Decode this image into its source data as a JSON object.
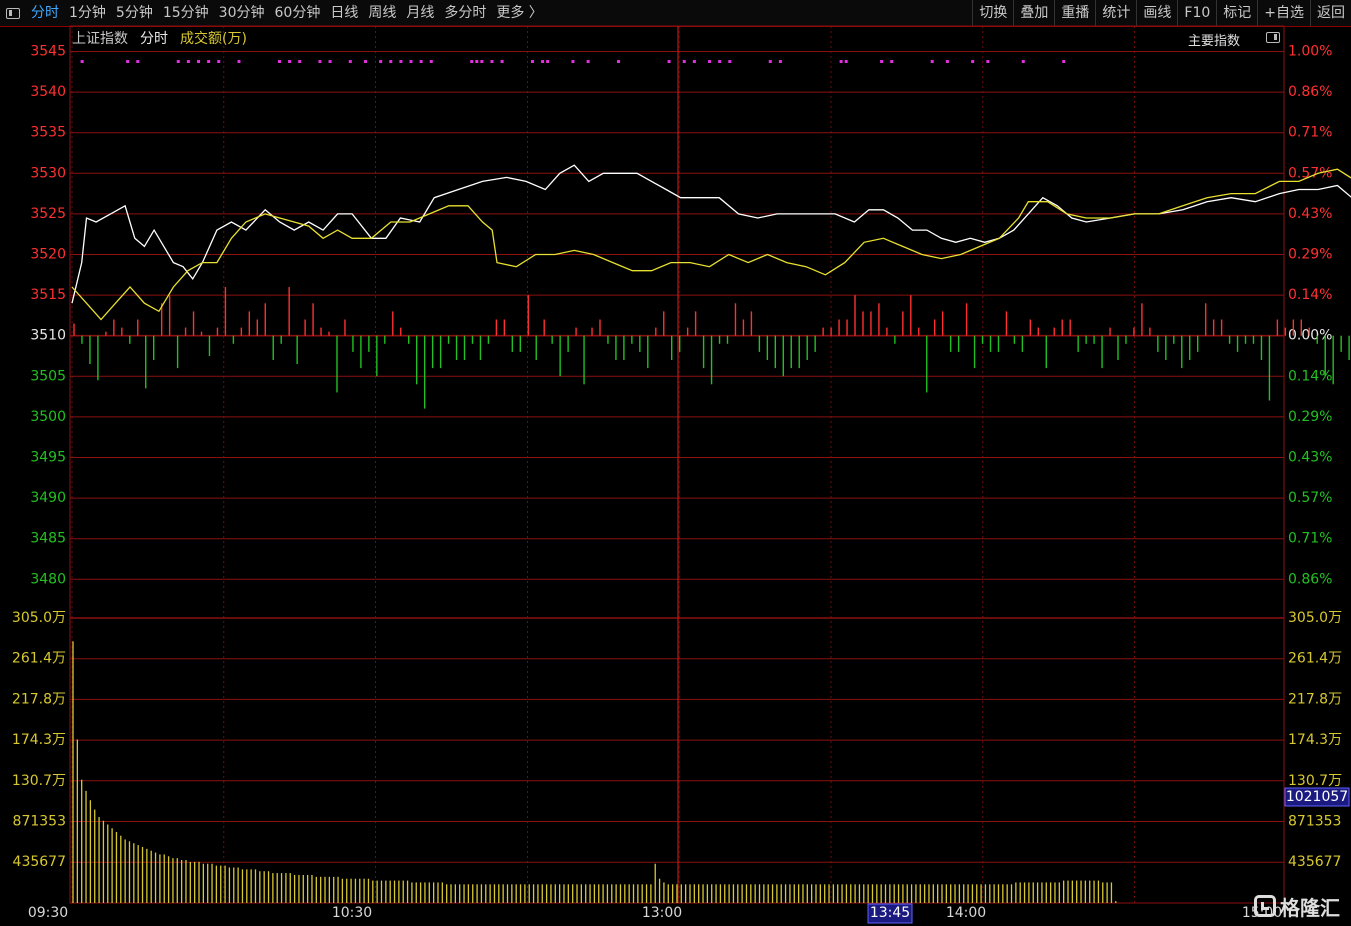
{
  "toolbar": {
    "left_items": [
      "分时",
      "1分钟",
      "5分钟",
      "15分钟",
      "30分钟",
      "60分钟",
      "日线",
      "周线",
      "月线",
      "多分时",
      "更多 〉"
    ],
    "right_items": [
      "切换",
      "叠加",
      "重播",
      "统计",
      "画线",
      "F10",
      "标记",
      "+自选",
      "返回"
    ],
    "active": "分时"
  },
  "header": {
    "index_name": "上证指数",
    "mode": "分时",
    "volume_label": "成交额(万)",
    "main_index_label": "主要指数"
  },
  "logo": {
    "text": "格隆汇"
  },
  "colors": {
    "up": "#ff3030",
    "down": "#22c022",
    "price_line": "#ffffff",
    "avg_line": "#e8e030",
    "grid": "#8b1010",
    "volume_bar": "#d8c830",
    "signal_marker": "#e030e0"
  },
  "chart_data": {
    "type": "line",
    "price_axis": {
      "ticks": [
        "3545",
        "3540",
        "3535",
        "3530",
        "3525",
        "3520",
        "3515",
        "3510",
        "3505",
        "3500",
        "3495",
        "3490",
        "3485",
        "3480"
      ],
      "ylim": [
        3478,
        3545
      ],
      "base": 3510
    },
    "pct_axis": {
      "ticks": [
        "1.00%",
        "0.86%",
        "0.71%",
        "0.57%",
        "0.43%",
        "0.29%",
        "0.14%",
        "0.00%",
        "0.14%",
        "0.29%",
        "0.43%",
        "0.57%",
        "0.71%",
        "0.86%"
      ]
    },
    "volume_axis": {
      "ticks": [
        "305.0万",
        "261.4万",
        "217.8万",
        "174.3万",
        "130.7万",
        "871353",
        "435677"
      ],
      "ylim": [
        0,
        3050000
      ]
    },
    "volume_cursor_label": "1021057",
    "time_axis": {
      "labels": [
        "09:30",
        "10:30",
        "13:00",
        "13:45",
        "14:00",
        "15:00"
      ],
      "highlight": "13:45"
    },
    "x_range": [
      0,
      240
    ],
    "cursor_minute": 150,
    "series": [
      {
        "name": "",
        "points": [
          [
            0,
            3514
          ],
          [
            2,
            3519
          ],
          [
            3,
            3524.5
          ],
          [
            5,
            3524
          ],
          [
            8,
            3525
          ],
          [
            11,
            3526
          ],
          [
            13,
            3522
          ],
          [
            15,
            3521
          ],
          [
            17,
            3523
          ],
          [
            19,
            3521
          ],
          [
            21,
            3519
          ],
          [
            23,
            3518.5
          ],
          [
            25,
            3517
          ],
          [
            27,
            3519
          ],
          [
            30,
            3523
          ],
          [
            33,
            3524
          ],
          [
            36,
            3523
          ],
          [
            40,
            3525.5
          ],
          [
            43,
            3524
          ],
          [
            46,
            3523
          ],
          [
            49,
            3524
          ],
          [
            52,
            3523
          ],
          [
            55,
            3525
          ],
          [
            58,
            3525
          ],
          [
            62,
            3522
          ],
          [
            65,
            3522
          ],
          [
            68,
            3524.5
          ],
          [
            72,
            3524
          ],
          [
            75,
            3527
          ],
          [
            80,
            3528
          ],
          [
            85,
            3529
          ],
          [
            90,
            3529.5
          ],
          [
            94,
            3529
          ],
          [
            98,
            3528
          ],
          [
            101,
            3530
          ],
          [
            104,
            3531
          ],
          [
            107,
            3529
          ],
          [
            110,
            3530
          ],
          [
            113,
            3530
          ],
          [
            117,
            3530
          ],
          [
            120,
            3529
          ],
          [
            123,
            3528
          ],
          [
            126,
            3527
          ],
          [
            130,
            3527
          ],
          [
            134,
            3527
          ],
          [
            138,
            3525
          ],
          [
            142,
            3524.5
          ],
          [
            146,
            3525
          ],
          [
            150,
            3525
          ],
          [
            154,
            3525
          ],
          [
            158,
            3525
          ],
          [
            162,
            3524
          ],
          [
            165,
            3525.5
          ],
          [
            168,
            3525.5
          ],
          [
            171,
            3524.5
          ],
          [
            174,
            3523
          ],
          [
            177,
            3523
          ],
          [
            180,
            3522
          ],
          [
            183,
            3521.5
          ],
          [
            186,
            3522
          ],
          [
            189,
            3521.5
          ],
          [
            192,
            3522
          ],
          [
            195,
            3523
          ],
          [
            198,
            3525
          ],
          [
            201,
            3527
          ],
          [
            204,
            3526
          ],
          [
            207,
            3524.5
          ],
          [
            210,
            3524
          ],
          [
            215,
            3524.5
          ],
          [
            220,
            3525
          ],
          [
            225,
            3525
          ],
          [
            230,
            3525.5
          ],
          [
            235,
            3526.5
          ],
          [
            240,
            3527
          ],
          [
            245,
            3526.5
          ],
          [
            250,
            3527.5
          ],
          [
            254,
            3528
          ],
          [
            258,
            3528
          ],
          [
            262,
            3528.5
          ],
          [
            266,
            3526.5
          ],
          [
            270,
            3524
          ],
          [
            274,
            3523
          ],
          [
            277,
            3523
          ]
        ],
        "color_key": "price_line"
      },
      {
        "name": "",
        "points": [
          [
            0,
            3516
          ],
          [
            3,
            3514
          ],
          [
            6,
            3512
          ],
          [
            9,
            3514
          ],
          [
            12,
            3516
          ],
          [
            15,
            3514
          ],
          [
            18,
            3513
          ],
          [
            21,
            3516
          ],
          [
            24,
            3518
          ],
          [
            27,
            3519
          ],
          [
            30,
            3519
          ],
          [
            33,
            3522
          ],
          [
            36,
            3524
          ],
          [
            40,
            3525
          ],
          [
            43,
            3524.5
          ],
          [
            46,
            3524
          ],
          [
            49,
            3523.5
          ],
          [
            52,
            3522
          ],
          [
            55,
            3523
          ],
          [
            58,
            3522
          ],
          [
            62,
            3522
          ],
          [
            66,
            3524
          ],
          [
            70,
            3524
          ],
          [
            74,
            3525
          ],
          [
            78,
            3526
          ],
          [
            82,
            3526
          ],
          [
            85,
            3524
          ],
          [
            87,
            3523
          ],
          [
            88,
            3519
          ],
          [
            92,
            3518.5
          ],
          [
            96,
            3520
          ],
          [
            100,
            3520
          ],
          [
            104,
            3520.5
          ],
          [
            108,
            3520
          ],
          [
            112,
            3519
          ],
          [
            116,
            3518
          ],
          [
            120,
            3518
          ],
          [
            124,
            3519
          ],
          [
            128,
            3519
          ],
          [
            132,
            3518.5
          ],
          [
            136,
            3520
          ],
          [
            140,
            3519
          ],
          [
            144,
            3520
          ],
          [
            148,
            3519
          ],
          [
            152,
            3518.5
          ],
          [
            156,
            3517.5
          ],
          [
            160,
            3519
          ],
          [
            164,
            3521.5
          ],
          [
            168,
            3522
          ],
          [
            172,
            3521
          ],
          [
            176,
            3520
          ],
          [
            180,
            3519.5
          ],
          [
            184,
            3520
          ],
          [
            188,
            3521
          ],
          [
            192,
            3522
          ],
          [
            196,
            3524.5
          ],
          [
            198,
            3526.5
          ],
          [
            202,
            3526.5
          ],
          [
            206,
            3525
          ],
          [
            210,
            3524.5
          ],
          [
            215,
            3524.5
          ],
          [
            220,
            3525
          ],
          [
            225,
            3525
          ],
          [
            230,
            3526
          ],
          [
            235,
            3527
          ],
          [
            240,
            3527.5
          ],
          [
            245,
            3527.5
          ],
          [
            250,
            3529
          ],
          [
            254,
            3529
          ],
          [
            258,
            3530
          ],
          [
            262,
            3530.5
          ],
          [
            266,
            3529
          ],
          [
            270,
            3528
          ],
          [
            274,
            3528.5
          ],
          [
            277,
            3528
          ]
        ],
        "color_key": "avg_line"
      }
    ],
    "diff_bars": [
      1.5,
      -1,
      -3.5,
      -5.5,
      0.5,
      2,
      1,
      -1,
      2,
      -6.5,
      -3,
      4,
      5,
      -4,
      1,
      3,
      0.5,
      -2.5,
      1,
      6,
      -1,
      1,
      3,
      2,
      4,
      -3,
      -1,
      6,
      -3.5,
      2,
      4,
      1,
      0.5,
      -7,
      2,
      -2,
      -4,
      -2,
      -5,
      -1,
      3,
      1,
      -1,
      -6,
      -9,
      -4,
      -4,
      -1,
      -3,
      -3,
      -1,
      -3,
      -1,
      2,
      2,
      -2,
      -2,
      5,
      -3,
      2,
      -1,
      -5,
      -2,
      1,
      -6,
      1,
      2,
      -1,
      -3,
      -3,
      -1,
      -2,
      -4,
      1,
      3,
      -3,
      -2,
      1,
      3,
      -4,
      -6,
      -1,
      -1,
      4,
      2,
      3,
      -2,
      -3,
      -4,
      -5,
      -4,
      -4,
      -3,
      -2,
      1,
      1,
      2,
      2,
      5,
      3,
      3,
      4,
      1,
      -1,
      3,
      5,
      1,
      -7,
      2,
      3,
      -2,
      -2,
      4,
      -4,
      -1,
      -2,
      -2,
      3,
      -1,
      -2,
      2,
      1,
      -4,
      1,
      2,
      2,
      -2,
      -1,
      -1,
      -4,
      1,
      -3,
      -1,
      1,
      4,
      1,
      -2,
      -3,
      -1,
      -4,
      -3,
      -2,
      4,
      2,
      2,
      -1,
      -2,
      -1,
      -1,
      -3,
      -8,
      2,
      1,
      2,
      2,
      1,
      -1,
      -5,
      -6,
      -2,
      -3,
      -1,
      3,
      -4,
      -4,
      -2,
      -1,
      -1,
      -1,
      -1,
      -1,
      1,
      3,
      1
    ],
    "volume_bars": [
      280,
      175,
      132,
      120,
      110,
      100,
      92,
      88,
      84,
      80,
      76,
      72,
      68,
      66,
      64,
      62,
      60,
      58,
      56,
      54,
      52,
      52,
      50,
      48,
      48,
      46,
      46,
      44,
      44,
      44,
      42,
      42,
      42,
      40,
      40,
      40,
      38,
      38,
      38,
      36,
      36,
      36,
      36,
      34,
      34,
      34,
      32,
      32,
      32,
      32,
      32,
      30,
      30,
      30,
      30,
      30,
      28,
      28,
      28,
      28,
      28,
      28,
      26,
      26,
      26,
      26,
      26,
      26,
      26,
      24,
      24,
      24,
      24,
      24,
      24,
      24,
      24,
      24,
      22,
      22,
      22,
      22,
      22,
      22,
      22,
      22,
      20,
      20,
      20,
      20,
      20,
      20,
      20,
      20,
      20,
      20,
      20,
      20,
      20,
      20,
      20,
      20,
      20,
      20,
      20,
      20,
      20,
      20,
      20,
      20,
      20,
      20,
      20,
      20,
      20,
      20,
      20,
      20,
      20,
      20,
      20,
      20,
      20,
      20,
      20,
      20,
      20,
      20,
      20,
      20,
      20,
      20,
      20,
      20,
      42,
      26,
      22,
      20,
      20,
      20,
      20,
      20,
      20,
      20,
      20,
      20,
      20,
      20,
      20,
      20,
      20,
      20,
      20,
      20,
      20,
      20,
      20,
      20,
      20,
      20,
      20,
      20,
      20,
      20,
      20,
      20,
      20,
      20,
      20,
      20,
      20,
      20,
      20,
      20,
      20,
      20,
      20,
      20,
      20,
      20,
      20,
      20,
      20,
      20,
      20,
      20,
      20,
      20,
      20,
      20,
      20,
      20,
      20,
      20,
      20,
      20,
      20,
      20,
      20,
      20,
      20,
      20,
      20,
      20,
      20,
      20,
      20,
      20,
      20,
      20,
      20,
      20,
      20,
      20,
      20,
      20,
      20,
      22,
      22,
      22,
      22,
      22,
      22,
      22,
      22,
      22,
      22,
      22,
      24,
      24,
      24,
      24,
      24,
      24,
      24,
      24,
      24,
      22,
      22,
      22,
      2
    ],
    "signal_markers": [
      2,
      11,
      13,
      21,
      23,
      25,
      27,
      29,
      33,
      41,
      43,
      45,
      49,
      51,
      55,
      58,
      61,
      63,
      65,
      67,
      69,
      71,
      79,
      80,
      81,
      83,
      85,
      91,
      93,
      94,
      99,
      102,
      108,
      118,
      121,
      123,
      126,
      128,
      130,
      138,
      140,
      152,
      153,
      160,
      162,
      170,
      173,
      178,
      181,
      188,
      196
    ]
  }
}
